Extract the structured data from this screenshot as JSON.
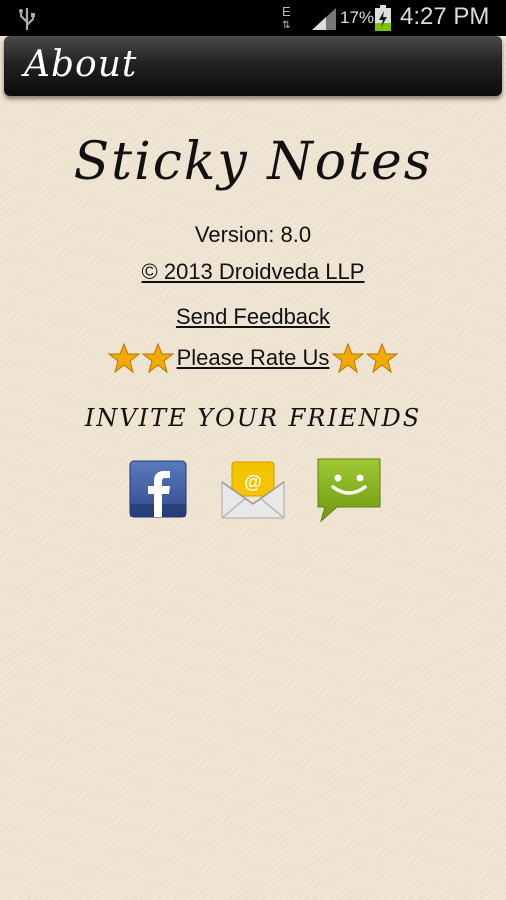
{
  "status_bar": {
    "network_type": "E",
    "battery_percent": "17%",
    "time": "4:27 PM"
  },
  "header": {
    "title": "About"
  },
  "about": {
    "app_name": "Sticky Notes",
    "version": "Version: 8.0",
    "copyright": "© 2013 Droidveda LLP",
    "feedback_link": "Send Feedback",
    "rate_link": "Please Rate Us",
    "invite_heading": "INVITE YOUR FRIENDS"
  },
  "share_options": [
    {
      "icon": "facebook-icon",
      "color": "#3b5998"
    },
    {
      "icon": "email-icon",
      "color": "#f5c400"
    },
    {
      "icon": "messaging-icon",
      "color": "#8ab31c"
    }
  ],
  "colors": {
    "background": "#efe4d2",
    "star": "#f2a900"
  }
}
